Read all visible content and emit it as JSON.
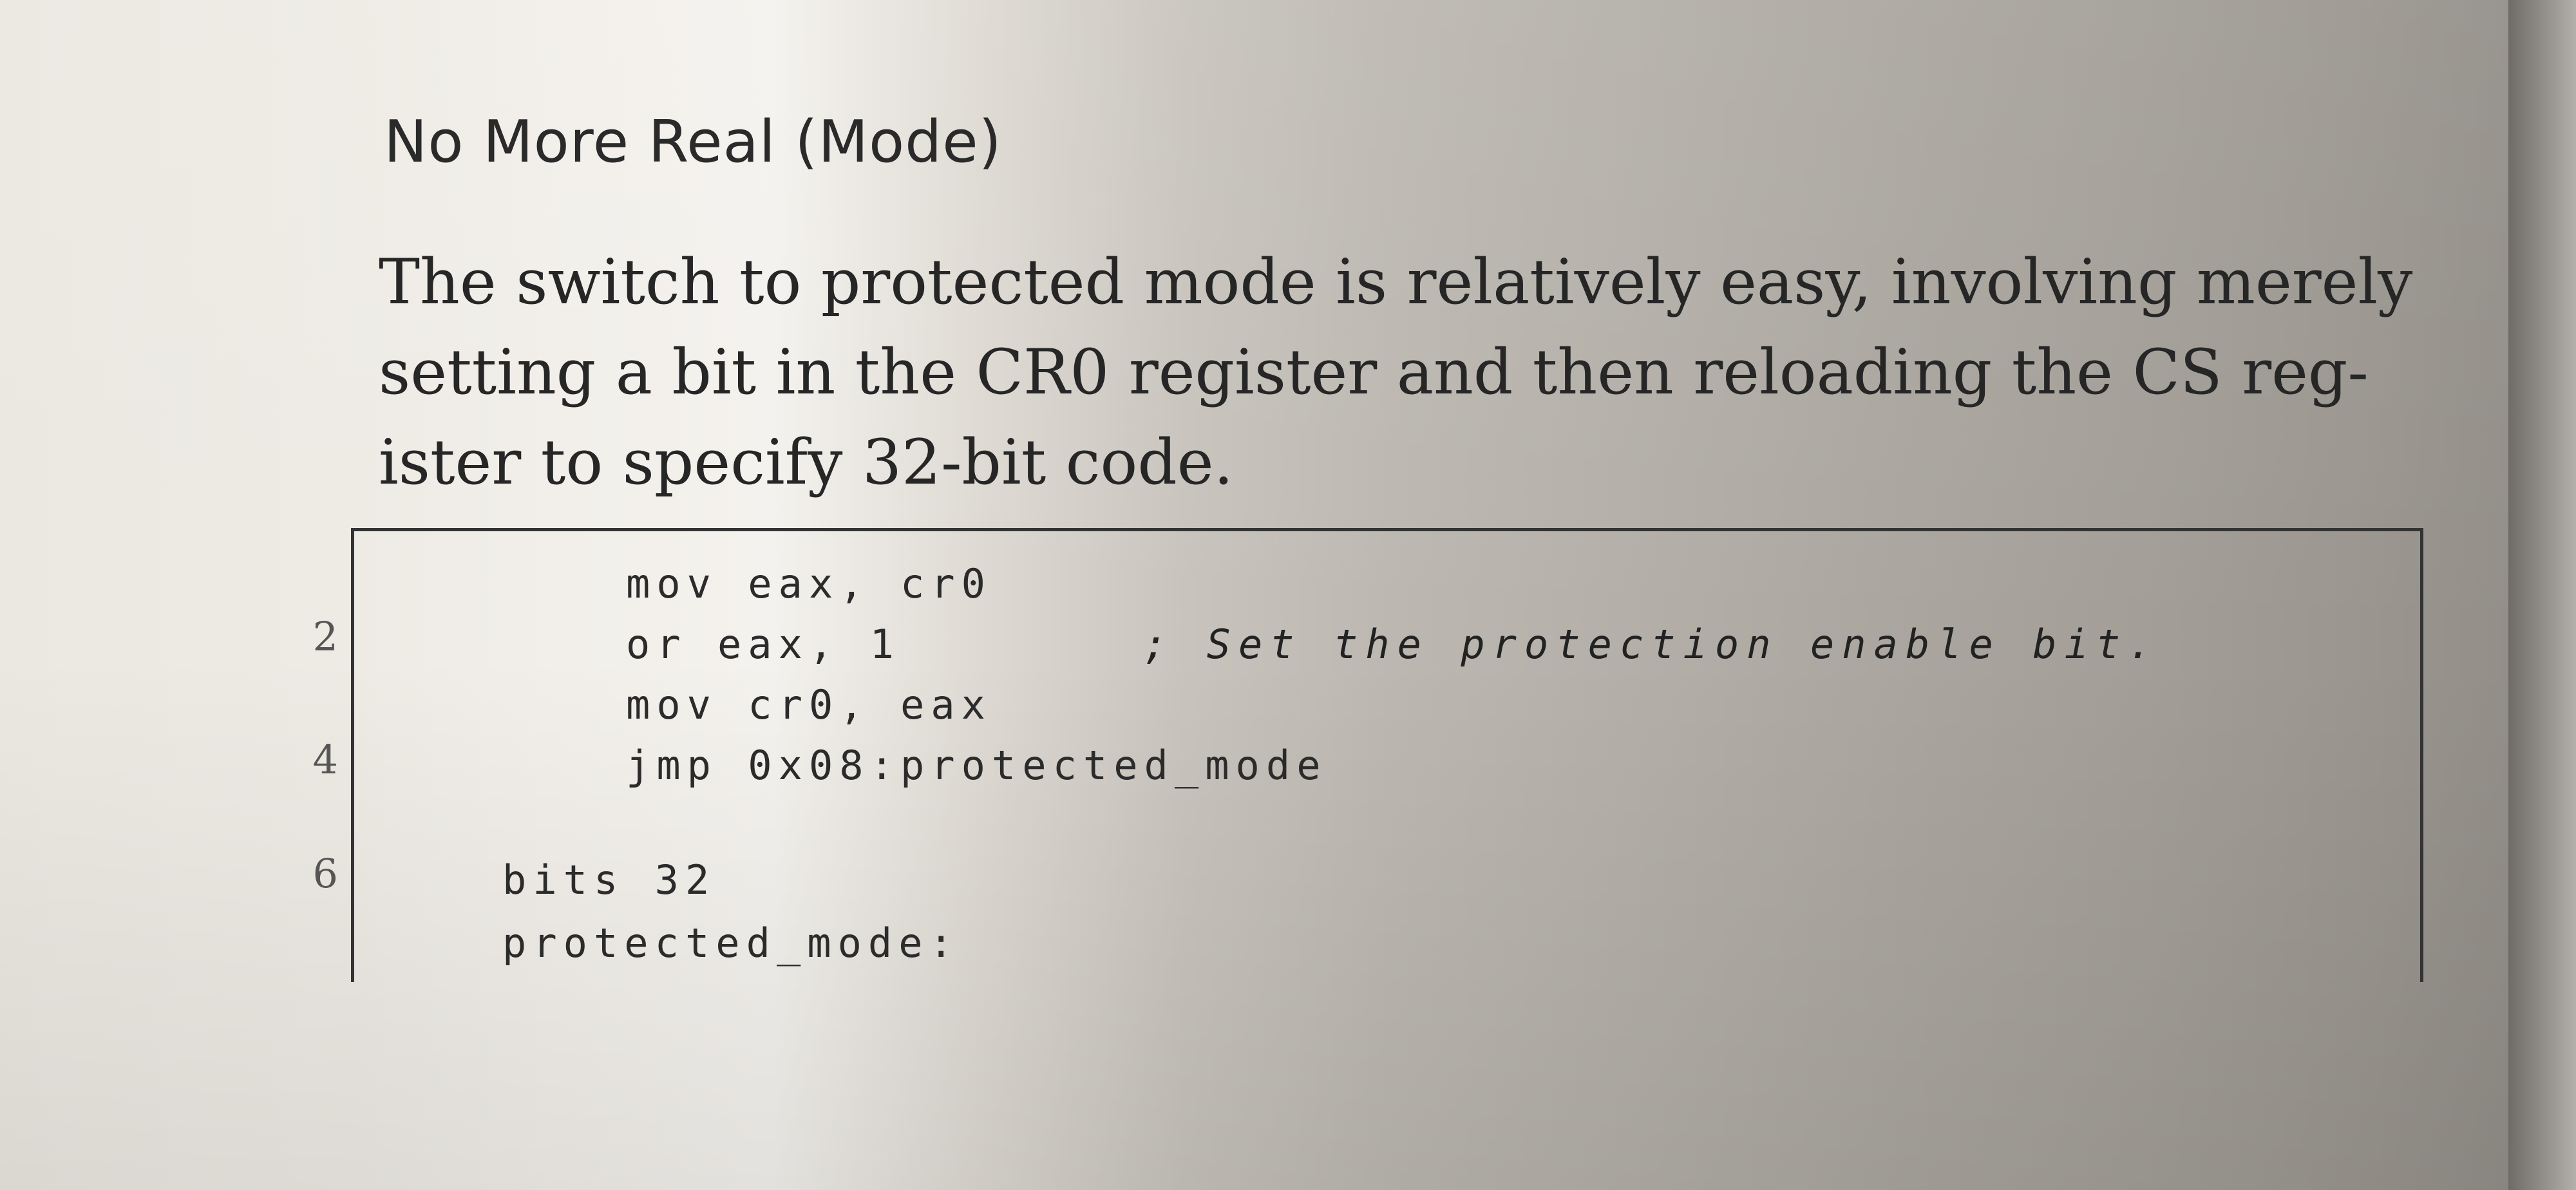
{
  "section": {
    "heading": "No More Real (Mode)",
    "paragraph_lines": [
      "The switch to protected mode is relatively easy, involving merely",
      "setting a bit in the CR0 register and then reloading the CS reg-",
      "ister to specify 32-bit code."
    ]
  },
  "code_listing": {
    "line_numbers": [
      "2",
      "4",
      "6"
    ],
    "lines": [
      "mov eax, cr0",
      "or eax, 1",
      "mov cr0, eax",
      "jmp 0x08:protected_mode",
      "bits 32",
      "protected_mode:"
    ],
    "comment": "; Set the protection enable bit."
  }
}
